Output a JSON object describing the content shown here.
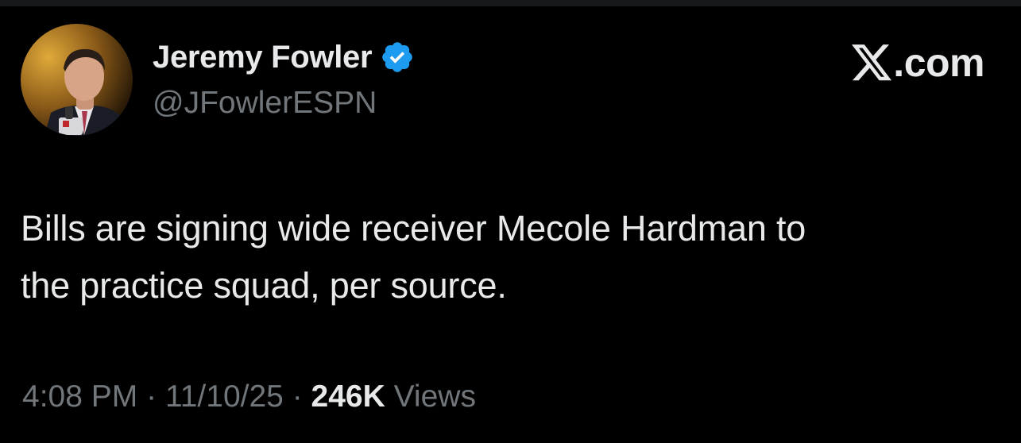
{
  "tweet": {
    "author": {
      "name": "Jeremy Fowler",
      "handle": "@JFowlerESPN",
      "verified": true,
      "avatar_icon": "profile-photo"
    },
    "brand": {
      "icon": "x-logo-icon",
      "text": ".com"
    },
    "text_line1": "Bills are signing wide receiver Mecole Hardman to",
    "text_line2": "the practice squad, per source.",
    "time": "4:08 PM",
    "separator": "·",
    "date": "11/10/25",
    "view_count": "246K",
    "views_label": "Views"
  },
  "colors": {
    "background": "#000000",
    "primary_text": "#e7e9ea",
    "secondary_text": "#71767b",
    "verified_badge": "#1d9bf0"
  }
}
